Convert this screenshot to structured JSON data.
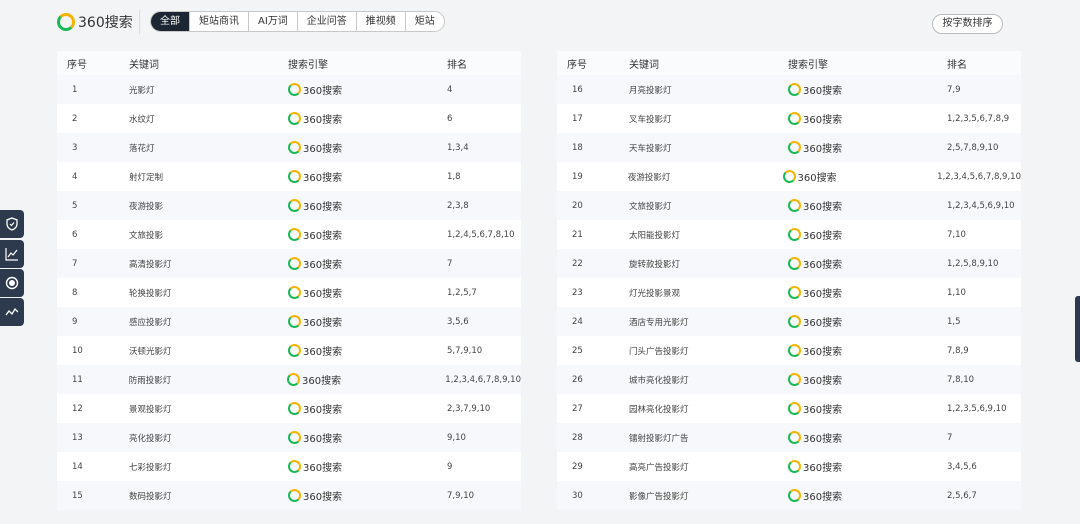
{
  "header": {
    "logo_text": "360搜索",
    "tabs": [
      {
        "label": "全部",
        "active": true
      },
      {
        "label": "矩站商讯",
        "active": false
      },
      {
        "label": "AI万词",
        "active": false
      },
      {
        "label": "企业问答",
        "active": false
      },
      {
        "label": "推视频",
        "active": false
      },
      {
        "label": "矩站",
        "active": false
      }
    ],
    "sort_button": "按字数排序"
  },
  "table_headers": {
    "index": "序号",
    "keyword": "关键词",
    "engine": "搜索引擎",
    "rank": "排名"
  },
  "engine_label": "360搜索",
  "left_rows": [
    {
      "index": "1",
      "keyword": "光影灯",
      "rank": "4"
    },
    {
      "index": "2",
      "keyword": "水纹灯",
      "rank": "6"
    },
    {
      "index": "3",
      "keyword": "落花灯",
      "rank": "1,3,4"
    },
    {
      "index": "4",
      "keyword": "射灯定制",
      "rank": "1,8"
    },
    {
      "index": "5",
      "keyword": "夜游投影",
      "rank": "2,3,8"
    },
    {
      "index": "6",
      "keyword": "文旅投影",
      "rank": "1,2,4,5,6,7,8,10"
    },
    {
      "index": "7",
      "keyword": "高清投影灯",
      "rank": "7"
    },
    {
      "index": "8",
      "keyword": "轮换投影灯",
      "rank": "1,2,5,7"
    },
    {
      "index": "9",
      "keyword": "感应投影灯",
      "rank": "3,5,6"
    },
    {
      "index": "10",
      "keyword": "沃顿光影灯",
      "rank": "5,7,9,10"
    },
    {
      "index": "11",
      "keyword": "防雨投影灯",
      "rank": "1,2,3,4,6,7,8,9,10"
    },
    {
      "index": "12",
      "keyword": "景观投影灯",
      "rank": "2,3,7,9,10"
    },
    {
      "index": "13",
      "keyword": "亮化投影灯",
      "rank": "9,10"
    },
    {
      "index": "14",
      "keyword": "七彩投影灯",
      "rank": "9"
    },
    {
      "index": "15",
      "keyword": "数码投影灯",
      "rank": "7,9,10"
    }
  ],
  "right_rows": [
    {
      "index": "16",
      "keyword": "月亮投影灯",
      "rank": "7,9"
    },
    {
      "index": "17",
      "keyword": "叉车投影灯",
      "rank": "1,2,3,5,6,7,8,9"
    },
    {
      "index": "18",
      "keyword": "天车投影灯",
      "rank": "2,5,7,8,9,10"
    },
    {
      "index": "19",
      "keyword": "夜游投影灯",
      "rank": "1,2,3,4,5,6,7,8,9,10"
    },
    {
      "index": "20",
      "keyword": "文旅投影灯",
      "rank": "1,2,3,4,5,6,9,10"
    },
    {
      "index": "21",
      "keyword": "太阳能投影灯",
      "rank": "7,10"
    },
    {
      "index": "22",
      "keyword": "旋转款投影灯",
      "rank": "1,2,5,8,9,10"
    },
    {
      "index": "23",
      "keyword": "灯光投影景观",
      "rank": "1,10"
    },
    {
      "index": "24",
      "keyword": "酒店专用光影灯",
      "rank": "1,5"
    },
    {
      "index": "25",
      "keyword": "门头广告投影灯",
      "rank": "7,8,9"
    },
    {
      "index": "26",
      "keyword": "城市亮化投影灯",
      "rank": "7,8,10"
    },
    {
      "index": "27",
      "keyword": "园林亮化投影灯",
      "rank": "1,2,3,5,6,9,10"
    },
    {
      "index": "28",
      "keyword": "镭射投影灯广告",
      "rank": "7"
    },
    {
      "index": "29",
      "keyword": "高亮广告投影灯",
      "rank": "3,4,5,6"
    },
    {
      "index": "30",
      "keyword": "影像广告投影灯",
      "rank": "2,5,6,7"
    }
  ],
  "side_icons": [
    "shield-icon",
    "line-chart-icon",
    "circle-target-icon",
    "trend-icon"
  ],
  "colors": {
    "brand_green": "#19b955",
    "brand_yellow": "#f5b400",
    "dark": "#1d2733",
    "sidebar": "#2d3a4d"
  }
}
